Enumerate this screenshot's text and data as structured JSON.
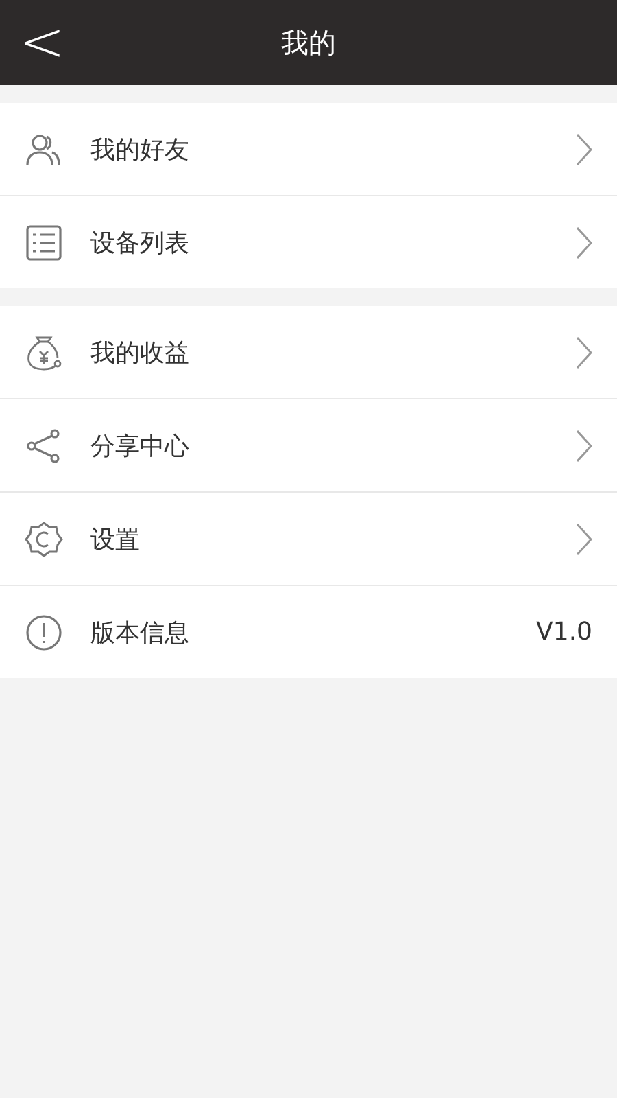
{
  "header": {
    "back": "<",
    "title": "我的"
  },
  "groups": [
    {
      "items": [
        {
          "kind": "link",
          "label": "我的好友"
        },
        {
          "kind": "link",
          "label": "设备列表"
        }
      ]
    },
    {
      "items": [
        {
          "kind": "link",
          "label": "我的收益"
        },
        {
          "kind": "link",
          "label": "分享中心"
        },
        {
          "kind": "link",
          "label": "设置"
        },
        {
          "kind": "info",
          "label": "版本信息",
          "value": "V1.0"
        }
      ]
    }
  ]
}
